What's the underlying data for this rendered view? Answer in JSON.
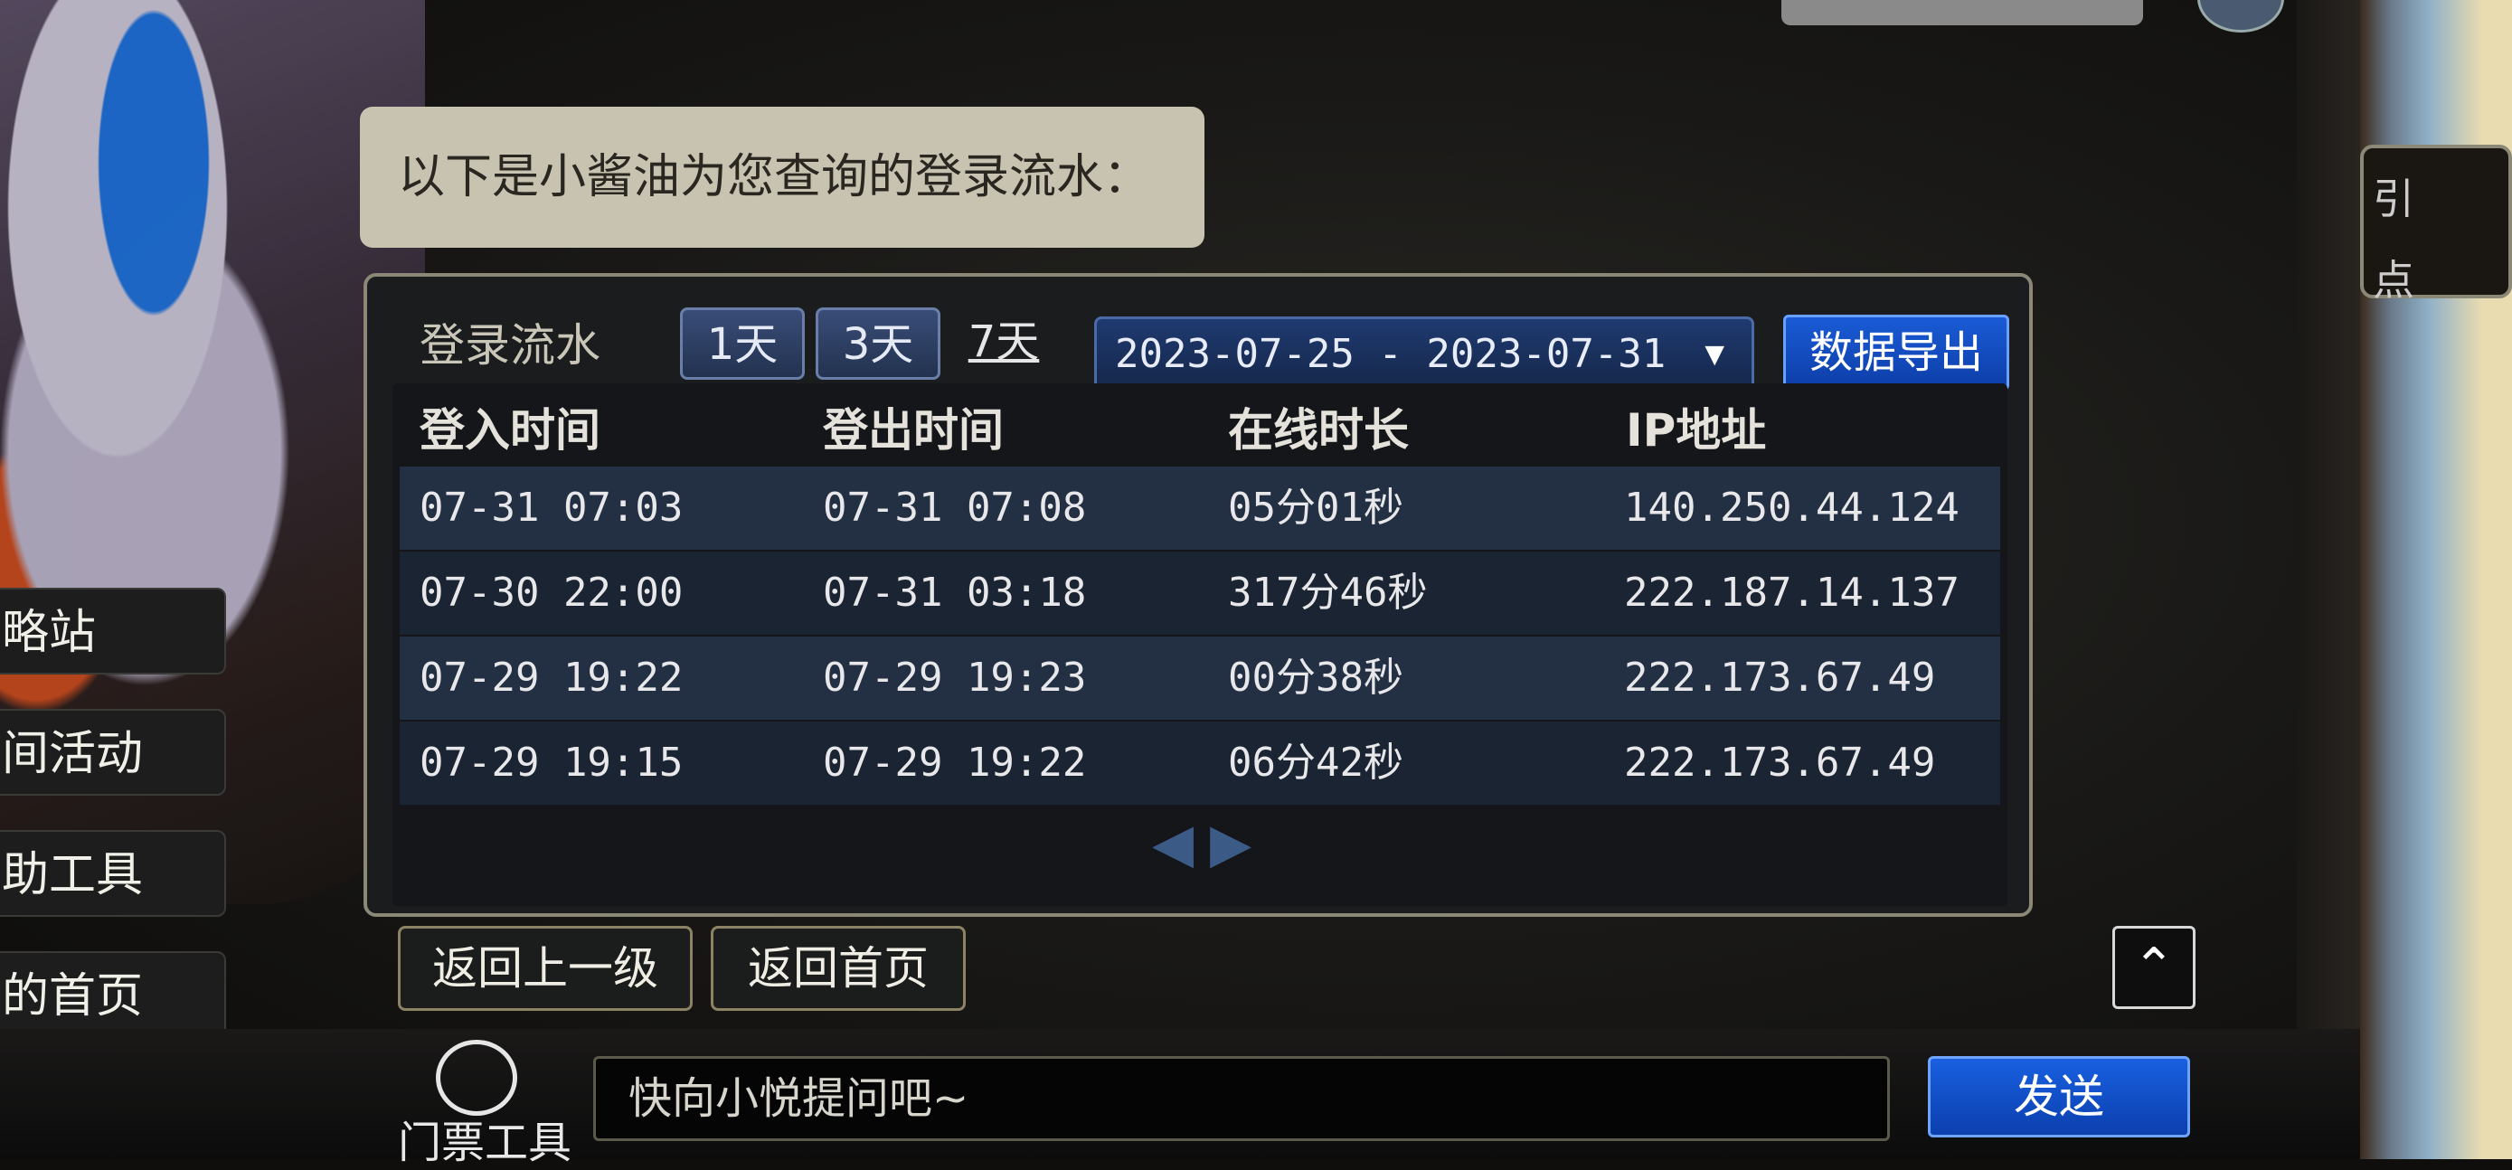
{
  "bubble_text": "以下是小酱油为您查询的登录流水：",
  "left_menu": [
    "略站",
    "间活动",
    "助工具",
    "的首页"
  ],
  "right_strip": {
    "texts": [
      "引",
      "点"
    ]
  },
  "login_panel": {
    "title": "登录流水",
    "range_buttons": [
      "1天",
      "3天",
      "7天"
    ],
    "selected_range": "7天",
    "date_range": "2023-07-25 - 2023-07-31",
    "export_button": "数据导出",
    "columns": [
      "登入时间",
      "登出时间",
      "在线时长",
      "IP地址"
    ],
    "rows": [
      {
        "login": "07-31 07:03",
        "logout": "07-31 07:08",
        "duration": "05分01秒",
        "ip": "140.250.44.124"
      },
      {
        "login": "07-30 22:00",
        "logout": "07-31 03:18",
        "duration": "317分46秒",
        "ip": "222.187.14.137"
      },
      {
        "login": "07-29 19:22",
        "logout": "07-29 19:23",
        "duration": "00分38秒",
        "ip": "222.173.67.49"
      },
      {
        "login": "07-29 19:15",
        "logout": "07-29 19:22",
        "duration": "06分42秒",
        "ip": "222.173.67.49"
      }
    ],
    "pager": {
      "prev": "◀",
      "next": "▶"
    }
  },
  "nav": {
    "back_label": "返回上一级",
    "home_label": "返回首页",
    "up_label": "⌃"
  },
  "bottom": {
    "ticket_label": "门票工具",
    "input_placeholder": "快向小悦提问吧~",
    "send_label": "发送"
  },
  "colors": {
    "accent_blue": "#1a5bd6",
    "panel_border": "#8b8878"
  }
}
